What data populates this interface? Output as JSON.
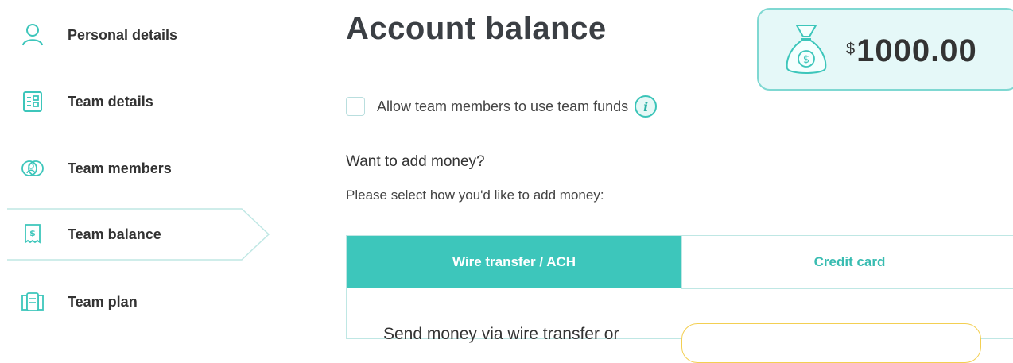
{
  "sidebar": {
    "items": [
      {
        "label": "Personal details",
        "icon": "person-icon"
      },
      {
        "label": "Team details",
        "icon": "team-details-icon"
      },
      {
        "label": "Team members",
        "icon": "team-members-icon"
      },
      {
        "label": "Team balance",
        "icon": "receipt-dollar-icon",
        "active": true
      },
      {
        "label": "Team plan",
        "icon": "plan-document-icon"
      }
    ]
  },
  "main": {
    "title": "Account balance",
    "balance": {
      "currency": "$",
      "value": "1000.00",
      "icon": "money-bag-icon"
    },
    "allow_funds": {
      "label": "Allow team members to use team funds",
      "checked": false
    },
    "add_money_heading": "Want to add money?",
    "add_money_instruction": "Please select how you'd like to add money:",
    "tabs": [
      {
        "label": "Wire transfer / ACH",
        "selected": true
      },
      {
        "label": "Credit card",
        "selected": false
      }
    ],
    "panel_text": "Send money via wire transfer or"
  },
  "colors": {
    "accent": "#3dc6bb",
    "accent_light": "#e5f8f8",
    "highlight_border": "#f3cf52"
  }
}
